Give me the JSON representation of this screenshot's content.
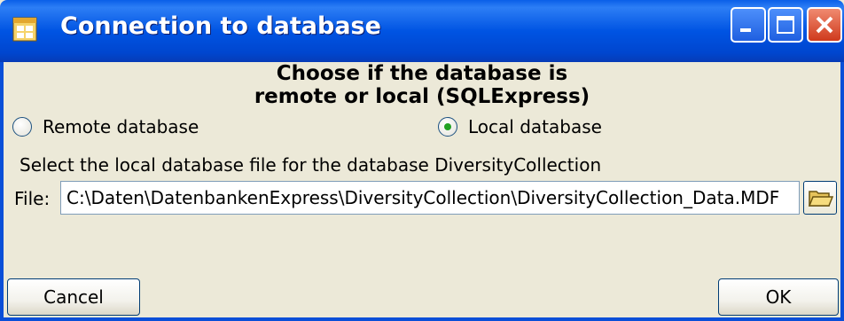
{
  "window": {
    "title": "Connection to database"
  },
  "heading": {
    "line1": "Choose if the database is",
    "line2": "remote or local (SQLExpress)"
  },
  "options": {
    "remote_label": "Remote database",
    "local_label": "Local database",
    "selected": "local"
  },
  "local": {
    "instruction": "Select the local database file for the database DiversityCollection",
    "file_label": "File:",
    "file_value": "C:\\Daten\\DatenbankenExpress\\DiversityCollection\\DiversityCollection_Data.MDF"
  },
  "buttons": {
    "cancel": "Cancel",
    "ok": "OK"
  },
  "icons": {
    "app": "app-window-icon",
    "minimize": "minimize-icon",
    "maximize": "maximize-icon",
    "close": "close-icon",
    "folder": "folder-open-icon"
  },
  "colors": {
    "titlebar": "#0054e3",
    "dialog_bg": "#ece9d8",
    "close_button": "#cf3a1d"
  }
}
